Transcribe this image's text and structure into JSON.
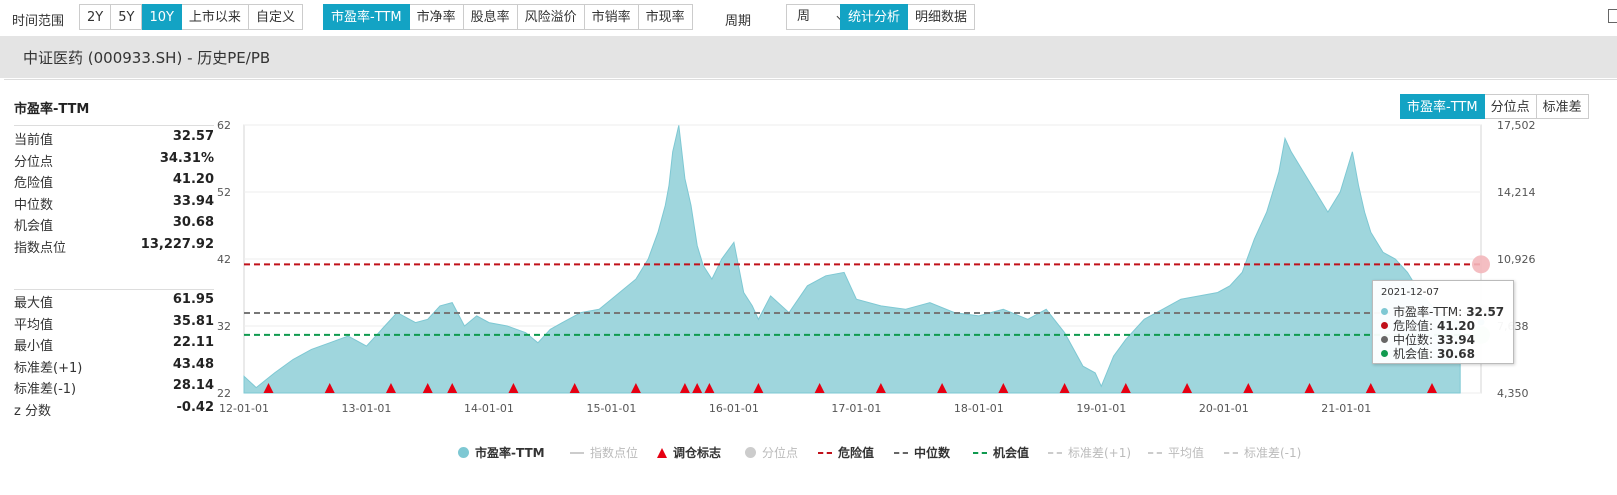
{
  "toolbar": {
    "time_range_label": "时间范围",
    "range_buttons": [
      "2Y",
      "5Y",
      "10Y",
      "上市以来",
      "自定义"
    ],
    "range_active": "10Y",
    "metric_buttons": [
      "市盈率-TTM",
      "市净率",
      "股息率",
      "风险溢价",
      "市销率",
      "市现率"
    ],
    "metric_active": "市盈率-TTM",
    "period_label": "周期",
    "period_value": "周",
    "view_buttons": [
      "统计分析",
      "明细数据"
    ],
    "view_active": "统计分析"
  },
  "page_title": "中证医药 (000933.SH) - 历史PE/PB",
  "left_panel": {
    "title": "市盈率-TTM",
    "stats_top": [
      {
        "label": "当前值",
        "value": "32.57"
      },
      {
        "label": "分位点",
        "value": "34.31%"
      },
      {
        "label": "危险值",
        "value": "41.20"
      },
      {
        "label": "中位数",
        "value": "33.94"
      },
      {
        "label": "机会值",
        "value": "30.68"
      },
      {
        "label": "指数点位",
        "value": "13,227.92"
      }
    ],
    "stats_bottom": [
      {
        "label": "最大值",
        "value": "61.95"
      },
      {
        "label": "平均值",
        "value": "35.81"
      },
      {
        "label": "最小值",
        "value": "22.11"
      },
      {
        "label": "标准差(+1)",
        "value": "43.48"
      },
      {
        "label": "标准差(-1)",
        "value": "28.14"
      },
      {
        "label": "z 分数",
        "value": "-0.42"
      }
    ]
  },
  "chart_tabs": [
    "市盈率-TTM",
    "分位点",
    "标准差"
  ],
  "chart_tab_active": "市盈率-TTM",
  "tooltip": {
    "date": "2021-12-07",
    "rows": [
      {
        "label": "市盈率-TTM:",
        "value": "32.57",
        "color": "#7ec8d3"
      },
      {
        "label": "危险值:",
        "value": "41.20",
        "color": "#c0111b"
      },
      {
        "label": "中位数:",
        "value": "33.94",
        "color": "#666666"
      },
      {
        "label": "机会值:",
        "value": "30.68",
        "color": "#0f9a4f"
      }
    ]
  },
  "legend": [
    {
      "label": "市盈率-TTM",
      "type": "dot",
      "color": "#7ec8d3",
      "enabled": true
    },
    {
      "label": "指数点位",
      "type": "line",
      "color": "#cccccc",
      "enabled": false
    },
    {
      "label": "调仓标志",
      "type": "triangle",
      "color": "#e60012",
      "enabled": true
    },
    {
      "label": "分位点",
      "type": "dot",
      "color": "#cccccc",
      "enabled": false
    },
    {
      "label": "危险值",
      "type": "dash",
      "color": "#c0111b",
      "enabled": true
    },
    {
      "label": "中位数",
      "type": "dash",
      "color": "#666666",
      "enabled": true
    },
    {
      "label": "机会值",
      "type": "dash",
      "color": "#0f9a4f",
      "enabled": true
    },
    {
      "label": "标准差(+1)",
      "type": "dash",
      "color": "#cccccc",
      "enabled": false
    },
    {
      "label": "平均值",
      "type": "dash",
      "color": "#cccccc",
      "enabled": false
    },
    {
      "label": "标准差(-1)",
      "type": "dash",
      "color": "#cccccc",
      "enabled": false
    }
  ],
  "chart_data": {
    "type": "area",
    "title": "市盈率-TTM",
    "x_tick_labels": [
      "12-01-01",
      "13-01-01",
      "14-01-01",
      "15-01-01",
      "16-01-01",
      "17-01-01",
      "18-01-01",
      "19-01-01",
      "20-01-01",
      "21-01-01"
    ],
    "y_left_ticks": [
      22,
      32,
      42,
      52,
      62
    ],
    "y_right_tick_labels": [
      "4,350",
      "7,638",
      "10,926",
      "14,214",
      "17,502"
    ],
    "ylim": [
      22,
      62
    ],
    "y_right_lim": [
      4350,
      17502
    ],
    "x_range_years": [
      2012.0,
      2022.1
    ],
    "series": [
      {
        "name": "市盈率-TTM",
        "x": [
          2012.0,
          2012.1,
          2012.25,
          2012.4,
          2012.55,
          2012.7,
          2012.85,
          2013.0,
          2013.15,
          2013.25,
          2013.4,
          2013.5,
          2013.6,
          2013.7,
          2013.8,
          2013.9,
          2014.0,
          2014.15,
          2014.3,
          2014.4,
          2014.5,
          2014.6,
          2014.75,
          2014.9,
          2015.0,
          2015.1,
          2015.2,
          2015.3,
          2015.38,
          2015.44,
          2015.47,
          2015.5,
          2015.55,
          2015.6,
          2015.65,
          2015.7,
          2015.75,
          2015.82,
          2015.9,
          2016.0,
          2016.08,
          2016.15,
          2016.2,
          2016.3,
          2016.45,
          2016.6,
          2016.75,
          2016.9,
          2017.0,
          2017.2,
          2017.4,
          2017.6,
          2017.8,
          2018.0,
          2018.2,
          2018.4,
          2018.55,
          2018.7,
          2018.85,
          2018.95,
          2019.0,
          2019.1,
          2019.2,
          2019.35,
          2019.5,
          2019.65,
          2019.8,
          2019.95,
          2020.05,
          2020.15,
          2020.25,
          2020.35,
          2020.45,
          2020.5,
          2020.55,
          2020.65,
          2020.75,
          2020.85,
          2020.95,
          2021.0,
          2021.05,
          2021.1,
          2021.15,
          2021.2,
          2021.3,
          2021.4,
          2021.5,
          2021.6,
          2021.7,
          2021.8,
          2021.9,
          2021.93
        ],
        "values": [
          24.5,
          22.8,
          25.0,
          27.0,
          28.5,
          29.5,
          30.5,
          29.0,
          32.0,
          34.0,
          32.5,
          33.0,
          35.0,
          35.5,
          32.0,
          33.5,
          32.5,
          32.0,
          31.0,
          29.5,
          31.5,
          32.5,
          34.0,
          34.5,
          36.0,
          37.5,
          39.0,
          42.0,
          46.0,
          50.0,
          53.0,
          58.0,
          61.95,
          54.0,
          50.0,
          44.0,
          41.0,
          39.0,
          42.0,
          44.5,
          37.0,
          35.0,
          33.0,
          36.5,
          34.0,
          38.0,
          39.5,
          40.0,
          36.0,
          35.0,
          34.5,
          35.5,
          34.0,
          33.5,
          34.5,
          33.0,
          34.5,
          31.0,
          26.0,
          25.0,
          23.0,
          27.5,
          30.0,
          33.0,
          34.5,
          36.0,
          36.5,
          37.0,
          38.0,
          40.0,
          45.0,
          49.0,
          55.0,
          60.0,
          58.0,
          55.0,
          52.0,
          49.0,
          52.0,
          55.0,
          58.0,
          53.0,
          49.0,
          46.0,
          43.0,
          42.0,
          40.0,
          37.0,
          35.0,
          33.5,
          33.0,
          32.57
        ]
      }
    ],
    "reference_lines": [
      {
        "name": "危险值",
        "value": 41.2,
        "color": "#c0111b"
      },
      {
        "name": "中位数",
        "value": 33.94,
        "color": "#777777"
      },
      {
        "name": "机会值",
        "value": 30.68,
        "color": "#0f9a4f"
      }
    ],
    "rebalance_markers_x": [
      2012.2,
      2012.7,
      2013.2,
      2013.5,
      2013.7,
      2014.2,
      2014.7,
      2015.2,
      2015.6,
      2015.7,
      2015.8,
      2016.2,
      2016.7,
      2017.2,
      2017.7,
      2018.2,
      2018.7,
      2019.2,
      2019.7,
      2020.2,
      2020.7,
      2021.2,
      2021.7
    ],
    "grid": true,
    "legend_position": "bottom"
  }
}
